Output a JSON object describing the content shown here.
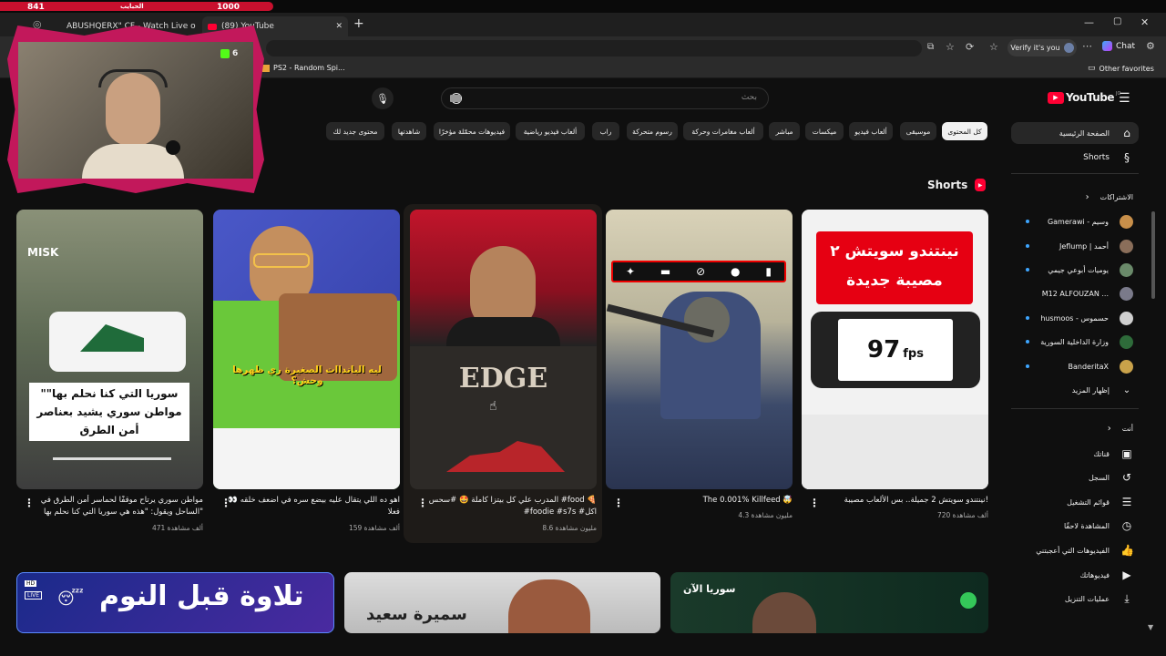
{
  "stream": {
    "left_count": "841",
    "center_label": "الحبايب",
    "right_count": "1000",
    "cam_badge": "6"
  },
  "tabs": [
    {
      "label": "ABUSHQERX\" CF - Watch Live o"
    },
    {
      "label": "(89) YouTube"
    }
  ],
  "browser": {
    "verify_label": "Verify it's you",
    "chat_label": "Chat",
    "bookmark": "PS2 - Random Spi...",
    "other_favorites": "Other favorites",
    "new_tab_symbol": "+"
  },
  "youtube": {
    "logo": "YouTube",
    "logo_sup": "JO",
    "search_placeholder": "بحث",
    "chips": [
      "كل المحتوى",
      "موسيقى",
      "ألعاب فيديو",
      "ميكسات",
      "مباشر",
      "ألعاب مغامرات وحركة",
      "رسوم متحركة",
      "راب",
      "ألعاب فيديو رياضية",
      "فيديوهات محمّلة مؤخرًا",
      "شاهدتها",
      "محتوى جديد لك"
    ],
    "sidebar": {
      "home": "الصفحة الرئيسية",
      "shorts": "Shorts",
      "subs_header": "الاشتراكات",
      "subs": [
        {
          "name": "Gamerawi - وسيم",
          "color": "#c88f4a"
        },
        {
          "name": "Jeflump | أحمد",
          "color": "#8a6e5a"
        },
        {
          "name": "يوميات أبوعي جيمي",
          "color": "#6a8a6a"
        },
        {
          "name": "M12 ALFOUZAN ...",
          "color": "#7a7a8a"
        },
        {
          "name": "husmoos - حسموس",
          "color": "#d0d0d0"
        },
        {
          "name": "وزارة الداخلية السورية",
          "color": "#2e6b3a"
        },
        {
          "name": "BanderitaX",
          "color": "#c9a24a"
        }
      ],
      "show_more": "إظهار المزيد",
      "you_header": "أنت",
      "you_items": [
        "قناتك",
        "السجل",
        "قوائم التشغيل",
        "المشاهدة لاحقًا",
        "الفيديوهات التي أعجبتني",
        "فيديوهاتك",
        "عمليات التنزيل"
      ]
    },
    "shorts_section_title": "Shorts",
    "shorts": [
      {
        "title": "نينتندو سويتش 2 جميلة.. بس الألعاب مصيبة!",
        "views": "720 ألف مشاهدة",
        "overlay": "نينتندو سويتش ٢ مصيبة جديدة",
        "fps": "97",
        "fps_unit": "fps"
      },
      {
        "title": "The 0.001% Killfeed 🤯",
        "views": "4.3 مليون مشاهدة"
      },
      {
        "title": "المدرب علي كل بيتزا كاملة 🤩 #سحس #food 🍕 #foodie #s7s #اكل",
        "views": "8.6 مليون مشاهدة",
        "overlay": "EDGE"
      },
      {
        "title": "اهو ده اللي يتقال عليه بيضع سره في اضعف خلقه 👀 فعلا",
        "views": "159 ألف مشاهدة",
        "overlay": "ليه البانداات الصغيرة ري ظهرها وحش؟"
      },
      {
        "title": "مواطن سوري يرتاح موقفًا لحماسر أمن الطرق في الساحل ويقول: \"هذه هي سوريا التي كنا نحلم بها\"",
        "views": "471 ألف مشاهدة",
        "overlay": "\"سوريا التي كنا نحلم بها\" مواطن سوري يشيد بعناصر أمن الطرق",
        "logo": "MISK"
      }
    ],
    "bottom": [
      {
        "text": "تلاوة قبل النوم",
        "badge1": "HD",
        "badge2": "LIVE"
      },
      {
        "text": "سميرة سعيد"
      },
      {
        "text": "سوريا الآن"
      }
    ]
  }
}
